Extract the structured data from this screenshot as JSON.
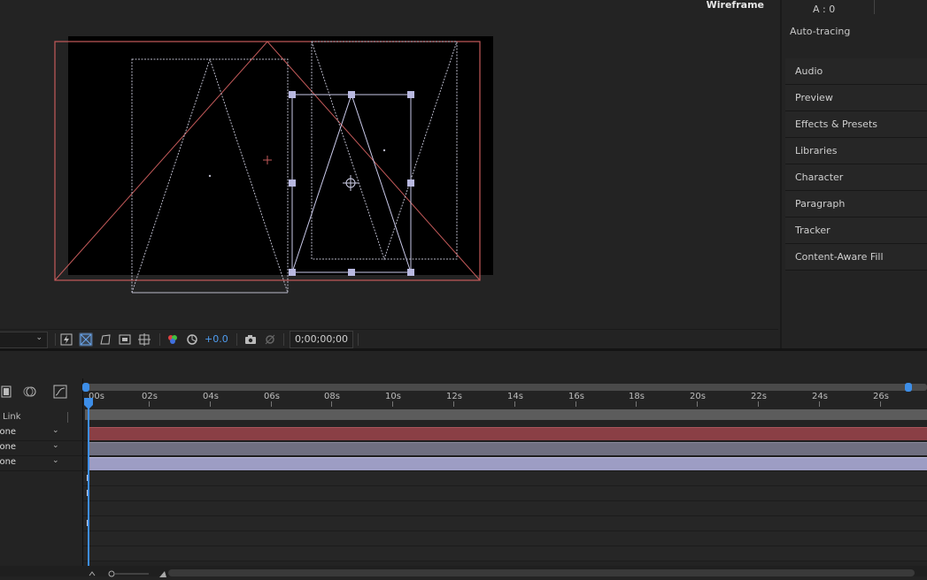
{
  "viewer": {
    "label": "Wireframe",
    "exposure": "+0.0",
    "timecode": "0;00;00;00"
  },
  "info": {
    "alpha_line": "A :  0"
  },
  "right_panel": {
    "autotracing": "Auto-tracing",
    "items": [
      {
        "label": "Audio"
      },
      {
        "label": "Preview"
      },
      {
        "label": "Effects & Presets"
      },
      {
        "label": "Libraries"
      },
      {
        "label": "Character"
      },
      {
        "label": "Paragraph"
      },
      {
        "label": "Tracker"
      },
      {
        "label": "Content-Aware Fill"
      }
    ]
  },
  "timeline": {
    "link_header": "Link",
    "ticks": [
      "00s",
      "02s",
      "04s",
      "06s",
      "08s",
      "10s",
      "12s",
      "14s",
      "16s",
      "18s",
      "20s",
      "22s",
      "24s",
      "26s"
    ],
    "layers": [
      {
        "parent": "None",
        "color": "#8a3f45"
      },
      {
        "parent": "None",
        "color": "#6f6f80"
      },
      {
        "parent": "None",
        "color": "#9d9dc4"
      }
    ]
  },
  "colors": {
    "accent": "#3d8ee8",
    "comp_bounds": "#c45a5a",
    "wire": "#b8b8c8",
    "selection": "#b8b8e0"
  }
}
